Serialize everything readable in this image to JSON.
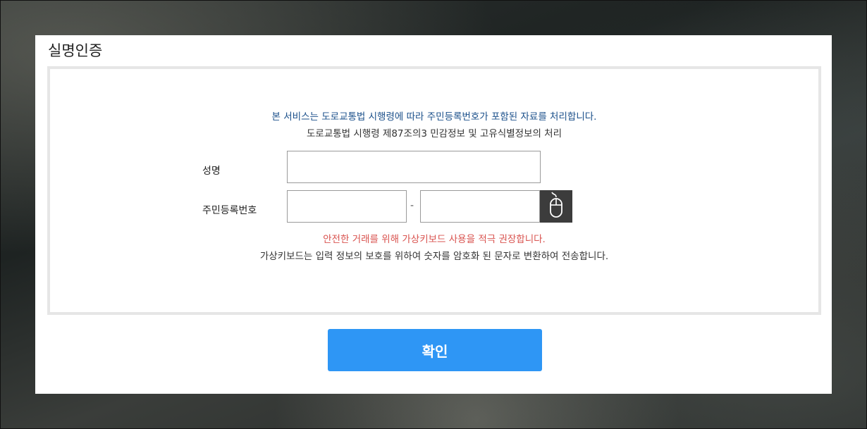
{
  "panel": {
    "title": "실명인증"
  },
  "notice": {
    "line1": "본 서비스는 도로교통법 시행령에 따라 주민등록번호가 포함된 자료를 처리합니다.",
    "line2": "도로교통법 시행령 제87조의3 민감정보 및 고유식별정보의 처리"
  },
  "form": {
    "name_label": "성명",
    "name_value": "",
    "rrn_label": "주민등록번호",
    "rrn_first_value": "",
    "rrn_separator": "-",
    "rrn_second_value": "",
    "virtual_keyboard_icon": "mouse-icon"
  },
  "keyboard_notice": {
    "warning": "안전한 거래를 위해 가상키보드 사용을 적극 권장합니다.",
    "description": "가상키보드는 입력 정보의 보호를 위하여 숫자를 암호화 된 문자로 변환하여 전송합니다."
  },
  "actions": {
    "confirm_label": "확인"
  },
  "colors": {
    "notice_blue": "#1a4f8a",
    "warning_red": "#d9534f",
    "confirm_button": "#2e96f5",
    "keyboard_button": "#3c3c3c"
  }
}
